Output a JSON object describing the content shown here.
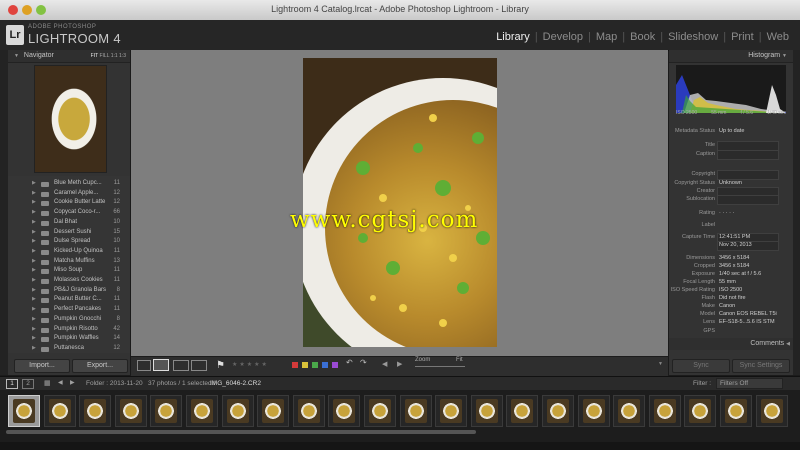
{
  "window": {
    "title": "Lightroom 4 Catalog.lrcat - Adobe Photoshop Lightroom - Library"
  },
  "brand": {
    "badge": "Lr",
    "small": "ADOBE PHOTOSHOP",
    "name": "LIGHTROOM 4"
  },
  "modules": [
    "Library",
    "Develop",
    "Map",
    "Book",
    "Slideshow",
    "Print",
    "Web"
  ],
  "active_module": "Library",
  "navigator": {
    "title": "Navigator",
    "fit": "FIT",
    "fill": "FILL",
    "r1": "1:1",
    "r2": "1:3"
  },
  "folders": [
    {
      "name": "Blue Meth Cupc...",
      "count": "11"
    },
    {
      "name": "Caramel Apple...",
      "count": "12"
    },
    {
      "name": "Cookie Butter Latte",
      "count": "12"
    },
    {
      "name": "Copycat Coco-r...",
      "count": "66"
    },
    {
      "name": "Dal Bhat",
      "count": "10"
    },
    {
      "name": "Dessert Sushi",
      "count": "15"
    },
    {
      "name": "Dulse Spread",
      "count": "10"
    },
    {
      "name": "Kicked-Up Quinoa",
      "count": "11"
    },
    {
      "name": "Matcha Muffins",
      "count": "13"
    },
    {
      "name": "Miso Soup",
      "count": "11"
    },
    {
      "name": "Molasses Cookies",
      "count": "11"
    },
    {
      "name": "PB&J Granola Bars",
      "count": "8"
    },
    {
      "name": "Peanut Butter C...",
      "count": "11"
    },
    {
      "name": "Perfect Pancakes",
      "count": "11"
    },
    {
      "name": "Pumpkin Gnocchi",
      "count": "8"
    },
    {
      "name": "Pumpkin Risotto",
      "count": "42"
    },
    {
      "name": "Pumpkin Waffles",
      "count": "14"
    },
    {
      "name": "Puttanesca",
      "count": "12"
    }
  ],
  "left_buttons": {
    "import": "Import...",
    "export": "Export..."
  },
  "histogram": {
    "title": "Histogram",
    "iso": "ISO 2500",
    "focal": "55 mm",
    "aperture": "f / 5.6",
    "shutter": "1/40 sec"
  },
  "metadata": [
    {
      "label": "Metadata Status",
      "value": "Up to date"
    },
    {
      "label": "Title",
      "value": ""
    },
    {
      "label": "Caption",
      "value": ""
    },
    {
      "label": "Copyright",
      "value": ""
    },
    {
      "label": "Copyright Status",
      "value": "Unknown"
    },
    {
      "label": "Creator",
      "value": ""
    },
    {
      "label": "Sublocation",
      "value": ""
    },
    {
      "label": "Rating",
      "value": "·  ·  ·  ·  ·"
    },
    {
      "label": "Label",
      "value": ""
    },
    {
      "label": "Capture Time",
      "value": "12:41:51 PM"
    },
    {
      "label": "",
      "value": "Nov 20, 2013"
    },
    {
      "label": "Dimensions",
      "value": "3456 x 5184"
    },
    {
      "label": "Cropped",
      "value": "3456 x 5184"
    },
    {
      "label": "Exposure",
      "value": "1/40 sec at f / 5.6"
    },
    {
      "label": "Focal Length",
      "value": "55 mm"
    },
    {
      "label": "ISO Speed Rating",
      "value": "ISO 2500"
    },
    {
      "label": "Flash",
      "value": "Did not fire"
    },
    {
      "label": "Make",
      "value": "Canon"
    },
    {
      "label": "Model",
      "value": "Canon EOS REBEL T5i"
    },
    {
      "label": "Lens",
      "value": "EF-S18-5...5.6 IS STM"
    },
    {
      "label": "GPS",
      "value": ""
    }
  ],
  "comments": {
    "title": "Comments"
  },
  "right_buttons": {
    "sync": "Sync",
    "sync_settings": "Sync Settings"
  },
  "toolbar": {
    "zoom": "Zoom",
    "fit": "Fit"
  },
  "filmstrip_bar": {
    "page1": "1",
    "page2": "2",
    "folder": "Folder : 2013-11-20",
    "count": "37 photos / 1 selected /",
    "file": "IMG_6046-2.CR2",
    "filter_label": "Filter :",
    "filter_value": "Filters Off"
  },
  "watermark": "www.cgtsj.com",
  "colors": {
    "label_red": "#d43a3a",
    "label_yellow": "#d9c23a",
    "label_green": "#4aa84a",
    "label_blue": "#3a6fd4",
    "label_purple": "#9a4ad4",
    "watermark": "#ffff00"
  }
}
